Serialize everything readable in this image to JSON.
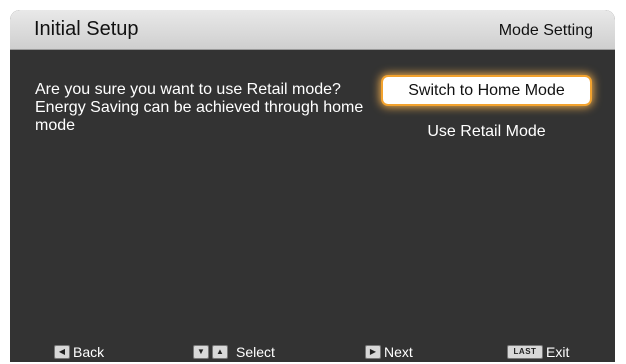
{
  "header": {
    "title": "Initial Setup",
    "section": "Mode Setting"
  },
  "dialog": {
    "message": "Are you sure you want to use Retail mode? Energy Saving can be achieved through home mode",
    "options": [
      {
        "label": "Switch to Home Mode",
        "selected": true
      },
      {
        "label": "Use Retail Mode",
        "selected": false
      }
    ]
  },
  "footer": {
    "back": {
      "key_icon": "left-arrow-key-icon",
      "label": "Back"
    },
    "select": {
      "key_icons": [
        "down-arrow-key-icon",
        "up-arrow-key-icon"
      ],
      "label": "Select"
    },
    "next": {
      "key_icon": "right-arrow-key-icon",
      "label": "Next"
    },
    "exit": {
      "key_label": "LAST",
      "label": "Exit"
    }
  },
  "colors": {
    "background": "#333333",
    "header": "#dcdcdc",
    "highlight": "#f2a22e"
  }
}
